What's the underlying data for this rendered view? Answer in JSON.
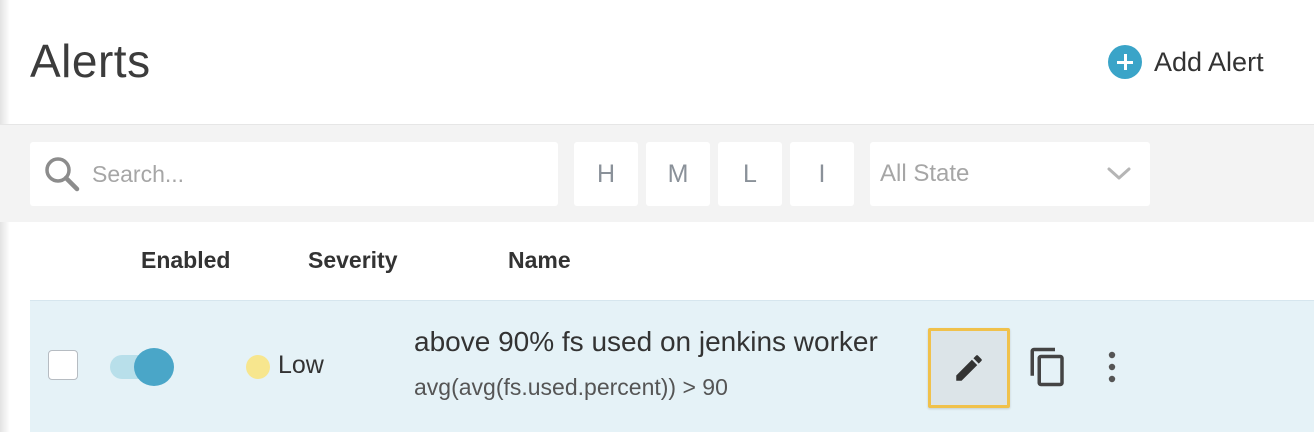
{
  "header": {
    "title": "Alerts",
    "add_alert_label": "Add Alert",
    "add_icon": "plus-circle-icon"
  },
  "filters": {
    "search_placeholder": "Search...",
    "search_value": "",
    "severity_buttons": [
      "H",
      "M",
      "L",
      "I"
    ],
    "state_select": "All State"
  },
  "table": {
    "columns": [
      "Enabled",
      "Severity",
      "Name"
    ],
    "rows": [
      {
        "selected": false,
        "enabled": true,
        "severity": "Low",
        "severity_color": "#f7e68e",
        "name": "above 90% fs used on jenkins worker",
        "query": "avg(avg(fs.used.percent)) > 90",
        "actions": [
          "pencil-icon",
          "copy-icon",
          "more-vertical-icon"
        ]
      }
    ]
  },
  "colors": {
    "accent": "#3aa4c8",
    "row_highlight": "#e5f2f7",
    "focus_outline": "#f0c14b"
  }
}
